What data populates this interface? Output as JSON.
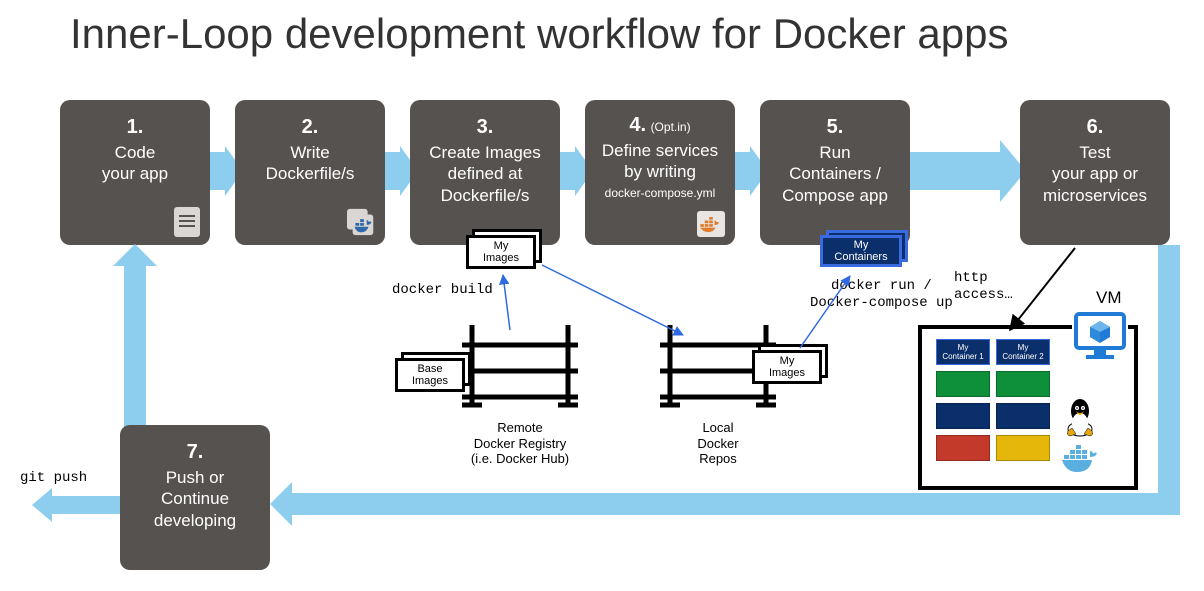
{
  "title": "Inner-Loop development workflow for Docker apps",
  "steps": {
    "s1": {
      "num": "1.",
      "text": "Code\nyour app"
    },
    "s2": {
      "num": "2.",
      "text": "Write\nDockerfile/s"
    },
    "s3": {
      "num": "3.",
      "text": "Create Images\ndefined at\nDockerfile/s"
    },
    "s4": {
      "num": "4.",
      "opt": "(Opt.in)",
      "text": "Define services\nby writing",
      "small": "docker-compose.yml"
    },
    "s5": {
      "num": "5.",
      "text": "Run\nContainers /\nCompose app"
    },
    "s6": {
      "num": "6.",
      "text": "Test\nyour app or\nmicroservices"
    },
    "s7": {
      "num": "7.",
      "text": "Push or\nContinue\ndeveloping"
    }
  },
  "badges": {
    "my_images_top": "My\nImages",
    "base_images": "Base\nImages",
    "my_images_local": "My\nImages",
    "my_containers": "My\nContainers"
  },
  "shelves": {
    "remote": "Remote\nDocker Registry\n(i.e. Docker Hub)",
    "local": "Local\nDocker\nRepos"
  },
  "vm": {
    "label": "VM",
    "c1": "My\nContainer 1",
    "c2": "My\nContainer 2"
  },
  "annotations": {
    "docker_build": "docker build",
    "docker_run": "docker run /\nDocker-compose up",
    "http_access": "http\naccess…",
    "git_push": "git push"
  },
  "colors": {
    "box": "#56524f",
    "arrow": "#8dceef",
    "navy": "#0b2f6a",
    "green": "#0e8f3a",
    "red": "#c43a2a",
    "gold": "#e5b70a"
  }
}
